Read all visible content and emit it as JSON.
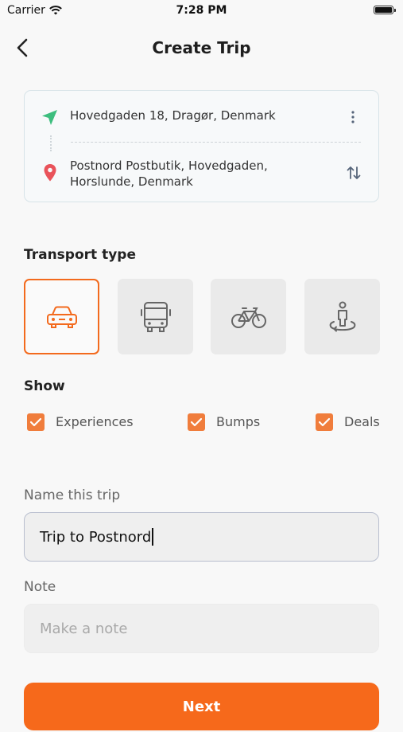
{
  "status_bar": {
    "carrier": "Carrier",
    "time": "7:28 PM"
  },
  "header": {
    "title": "Create Trip"
  },
  "route": {
    "origin": "Hovedgaden 18, Dragør, Denmark",
    "destination_line1": "Postnord Postbutik, Hovedgaden,",
    "destination_line2": "Horslunde, Denmark"
  },
  "transport": {
    "label": "Transport type",
    "options": [
      {
        "icon": "car-icon",
        "selected": true
      },
      {
        "icon": "bus-icon",
        "selected": false
      },
      {
        "icon": "bicycle-icon",
        "selected": false
      },
      {
        "icon": "walking-person-icon",
        "selected": false
      }
    ]
  },
  "show": {
    "label": "Show",
    "items": [
      {
        "label": "Experiences",
        "checked": true
      },
      {
        "label": "Bumps",
        "checked": true
      },
      {
        "label": "Deals",
        "checked": true
      }
    ]
  },
  "trip_name": {
    "label": "Name this trip",
    "value": "Trip to Postnord"
  },
  "note": {
    "label": "Note",
    "placeholder": "Make a note",
    "value": ""
  },
  "next_button": {
    "label": "Next"
  },
  "colors": {
    "accent": "#F6691B",
    "checkbox": "#F07D3C",
    "origin_icon": "#3DBE7E",
    "destination_icon": "#E9535A"
  }
}
